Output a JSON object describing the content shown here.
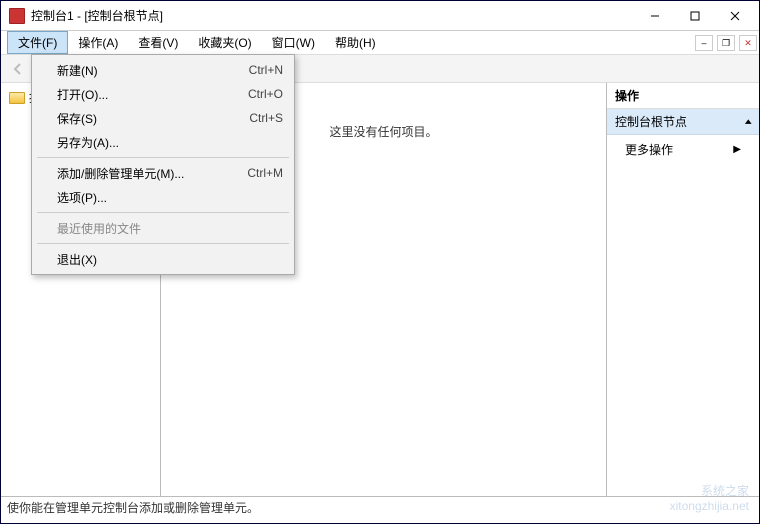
{
  "title": "控制台1 - [控制台根节点]",
  "window_controls": {
    "minimize": "–",
    "maximize": "☐",
    "close": "✕"
  },
  "menubar": {
    "items": [
      {
        "label": "文件(F)"
      },
      {
        "label": "操作(A)"
      },
      {
        "label": "查看(V)"
      },
      {
        "label": "收藏夹(O)"
      },
      {
        "label": "窗口(W)"
      },
      {
        "label": "帮助(H)"
      }
    ]
  },
  "dropdown": {
    "items": [
      {
        "label": "新建(N)",
        "shortcut": "Ctrl+N"
      },
      {
        "label": "打开(O)...",
        "shortcut": "Ctrl+O"
      },
      {
        "label": "保存(S)",
        "shortcut": "Ctrl+S"
      },
      {
        "label": "另存为(A)...",
        "shortcut": ""
      },
      "sep",
      {
        "label": "添加/删除管理单元(M)...",
        "shortcut": "Ctrl+M"
      },
      {
        "label": "选项(P)...",
        "shortcut": ""
      },
      "sep",
      {
        "label": "最近使用的文件",
        "shortcut": "",
        "disabled": true
      },
      "sep",
      {
        "label": "退出(X)",
        "shortcut": ""
      }
    ]
  },
  "tree": {
    "root": "控制台根节点"
  },
  "center": {
    "empty_text": "这里没有任何项目。"
  },
  "right": {
    "header": "操作",
    "section": "控制台根节点",
    "more_actions": "更多操作"
  },
  "statusbar": "使你能在管理单元控制台添加或删除管理单元。",
  "watermark": {
    "l1": "系统之家",
    "l2": "xitongzhijia.net"
  }
}
